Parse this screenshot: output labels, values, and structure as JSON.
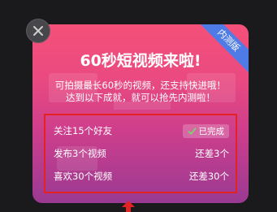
{
  "ribbon": "内测版",
  "title": "60秒短视频来啦!",
  "subtitle_lines": [
    "可拍摄最长60秒的视频，还支持快进哦！",
    "达到以下成就，就可以抢先内测啦！"
  ],
  "tasks": [
    {
      "label": "关注15个好友",
      "status": "已完成",
      "completed": true
    },
    {
      "label": "发布3个视频",
      "status": "还差3个",
      "completed": false
    },
    {
      "label": "喜欢30个视频",
      "status": "还差30个",
      "completed": false
    }
  ],
  "colors": {
    "card_top": "#f5507a",
    "card_bottom": "#9a3a93",
    "ribbon": "#4f7be6",
    "highlight_box": "#e32222",
    "check": "#7bd36b"
  },
  "icons": {
    "close": "close-icon",
    "check": "check-icon",
    "pointer": "arrow-pointer-icon"
  }
}
